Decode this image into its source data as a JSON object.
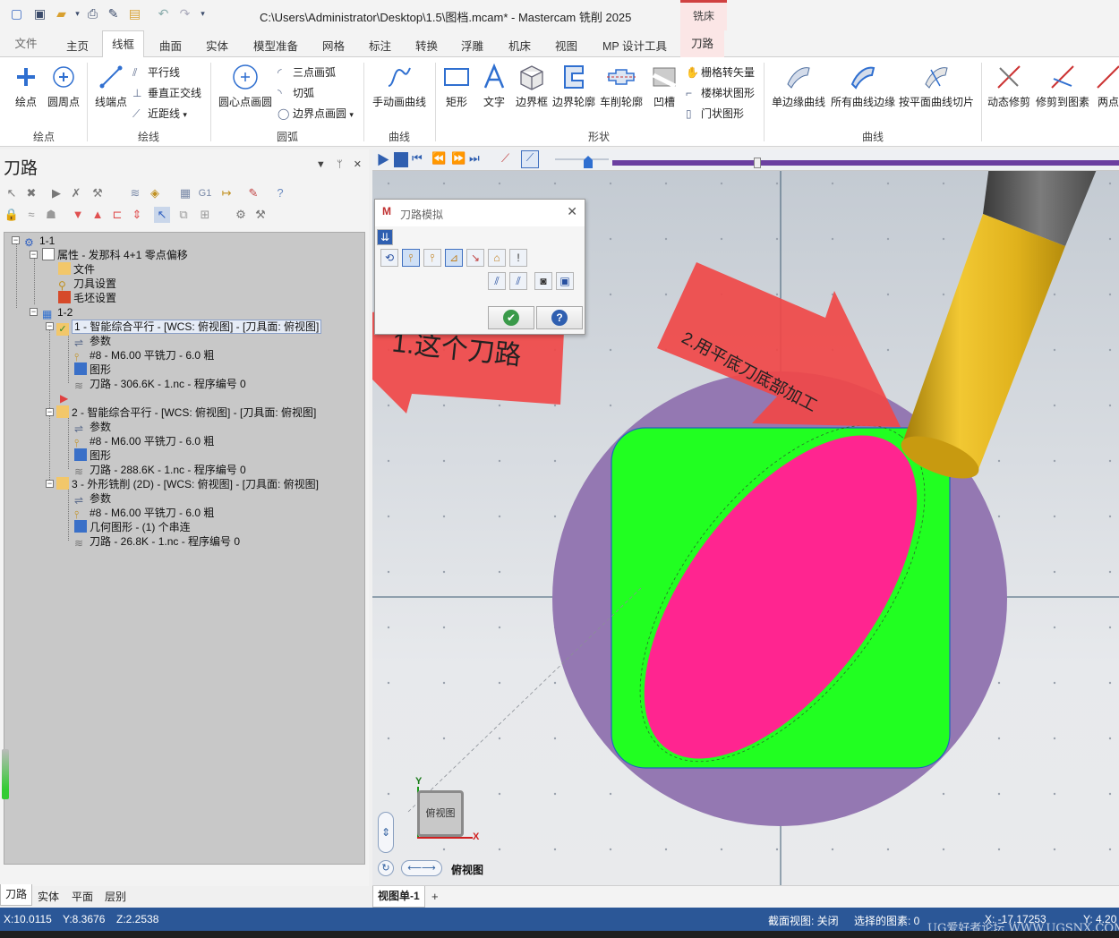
{
  "titlebar": {
    "title": "C:\\Users\\Administrator\\Desktop\\1.5\\图档.mcam* - Mastercam 铣削 2025",
    "context_label": "铣床"
  },
  "tabs": [
    "文件",
    "主页",
    "线框",
    "曲面",
    "实体",
    "模型准备",
    "网格",
    "标注",
    "转换",
    "浮雕",
    "机床",
    "视图",
    "MP 设计工具",
    "刀路"
  ],
  "active_tab": "线框",
  "ribbon": {
    "draw_point": "绘点",
    "circle_points": "圆周点",
    "line_endpoints": "线端点",
    "parallel": "平行线",
    "perpendicular": "垂直正交线",
    "closest_line": "近距线",
    "circle_center": "圆心点画圆",
    "arc_3pt": "三点画弧",
    "tangent_arc": "切弧",
    "edge_circle": "边界点画圆",
    "manual_curve": "手动画曲线",
    "rectangle": "矩形",
    "text": "文字",
    "bounding_box": "边界框",
    "boundary_profile": "边界轮廓",
    "turn_profile": "车削轮廓",
    "groove": "凹槽",
    "grid_to_vector": "栅格转矢量",
    "stair_shape": "楼梯状图形",
    "door_shape": "门状图形",
    "single_edge_curve": "单边缘曲线",
    "all_edge_curve": "所有曲线边缘",
    "plane_slice": "按平面曲线切片",
    "dynamic_trim": "动态修剪",
    "trim_to_entity": "修剪到图素",
    "two_point": "两点",
    "groups": {
      "points": "绘点",
      "lines": "绘线",
      "arcs": "圆弧",
      "curves": "曲线",
      "shapes": "形状",
      "curves2": "曲线"
    }
  },
  "left_panel": {
    "title": "刀路",
    "tree": {
      "machine_group": "1-1",
      "properties": "属性 - 发那科 4+1 零点偏移",
      "files": "文件",
      "tool_settings": "刀具设置",
      "stock_settings": "毛坯设置",
      "toolpath_group": "1-2",
      "ops": [
        {
          "name": "1 - 智能综合平行 - [WCS: 俯视图] - [刀具面: 俯视图]",
          "params": "参数",
          "tool": "#8 - M6.00 平铣刀 - 6.0 粗",
          "geometry": "图形",
          "toolpath": "刀路 - 306.6K - 1.nc - 程序编号 0"
        },
        {
          "name": "2 - 智能综合平行 - [WCS: 俯视图] - [刀具面: 俯视图]",
          "params": "参数",
          "tool": "#8 - M6.00 平铣刀 - 6.0 粗",
          "geometry": "图形",
          "toolpath": "刀路 - 288.6K - 1.nc - 程序编号 0"
        },
        {
          "name": "3 - 外形铣削 (2D) - [WCS: 俯视图] - [刀具面: 俯视图]",
          "params": "参数",
          "tool": "#8 - M6.00 平铣刀 - 6.0 粗",
          "geometry": "几何图形 - (1) 个串连",
          "toolpath": "刀路 - 26.8K - 1.nc - 程序编号 0"
        }
      ]
    },
    "bottom_tabs": [
      "刀路",
      "实体",
      "平面",
      "层别"
    ]
  },
  "sim_dialog": {
    "title": "刀路模拟"
  },
  "annotations": {
    "arrow1": "1.这个刀路",
    "arrow2": "2.用平底刀底部加工"
  },
  "viewport": {
    "view_name": "俯视图",
    "cube_label": "俯视图",
    "axis_x": "X",
    "axis_y": "Y",
    "tab": "视图单-1",
    "add_tab": "+"
  },
  "statusbar": {
    "x": "X:10.0115",
    "y": "Y:8.3676",
    "z": "Z:2.2538",
    "section_view": "截面视图: 关闭",
    "selected": "选择的图素: 0",
    "x2": "X: -17.17253",
    "y2": "Y: 4.20",
    "watermark": "UG爱好者论坛 WWW.UGSNX.COM"
  },
  "colors": {
    "green": "#21ff21",
    "pink": "#ff2590",
    "purple": "#9478b2",
    "arrow_red": "#f04848",
    "tool_gold": "#e0b21c",
    "status_blue": "#2b5797"
  }
}
